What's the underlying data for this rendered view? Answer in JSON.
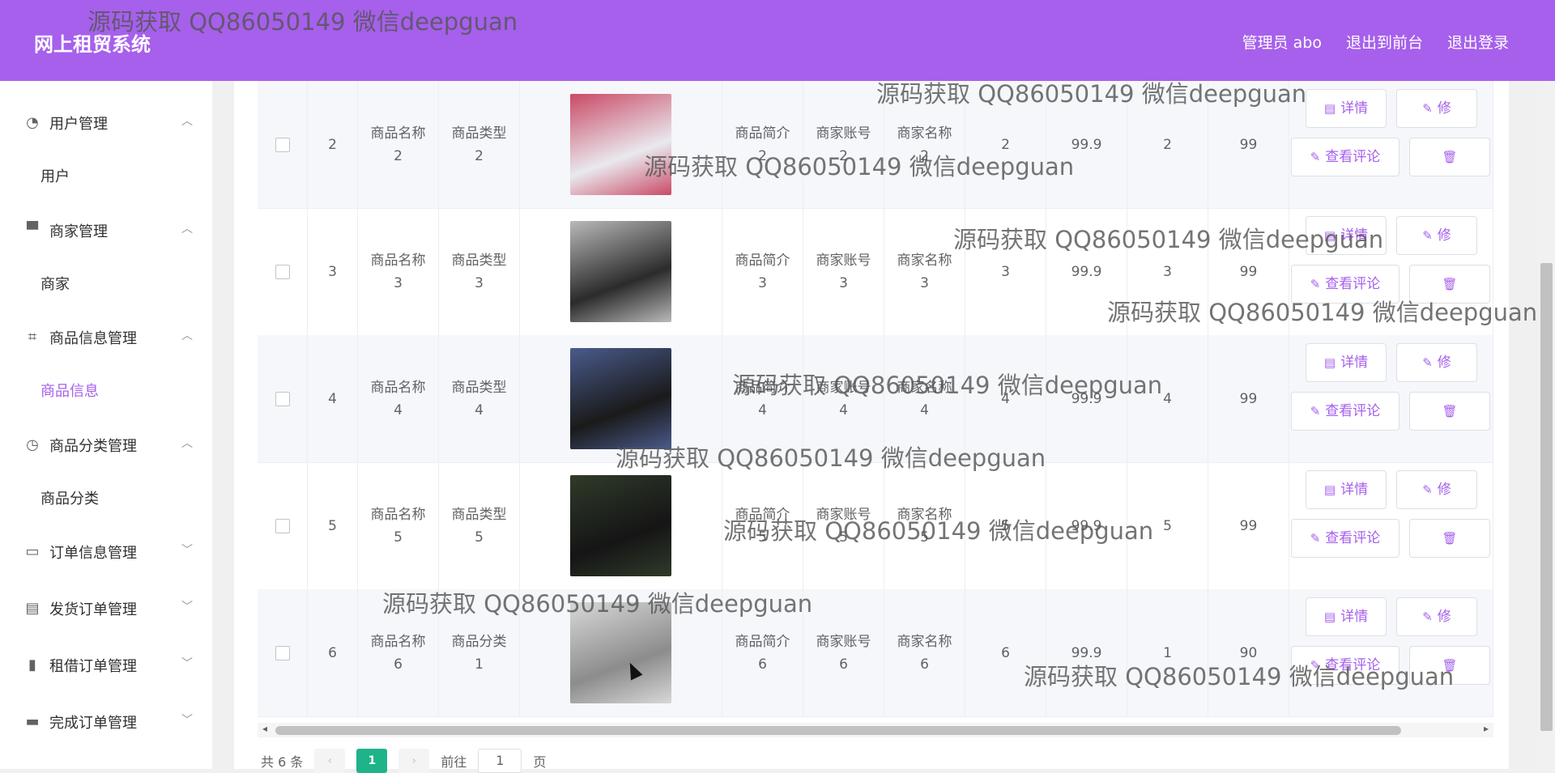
{
  "header": {
    "app_title": "网上租贸系统",
    "nav": [
      "管理员 abo",
      "退出到前台",
      "退出登录"
    ]
  },
  "sidebar": {
    "groups": [
      {
        "icon": "dashboard-icon",
        "label": "用户管理",
        "expanded": true,
        "items": [
          "用户"
        ]
      },
      {
        "icon": "brush-icon",
        "label": "商家管理",
        "expanded": true,
        "items": [
          "商家"
        ]
      },
      {
        "icon": "crop-icon",
        "label": "商品信息管理",
        "expanded": true,
        "items": [
          "商品信息"
        ],
        "active_item": "商品信息"
      },
      {
        "icon": "clock-icon",
        "label": "商品分类管理",
        "expanded": true,
        "items": [
          "商品分类"
        ]
      },
      {
        "icon": "chat-icon",
        "label": "订单信息管理",
        "expanded": false,
        "items": []
      },
      {
        "icon": "clipboard-icon",
        "label": "发货订单管理",
        "expanded": false,
        "items": []
      },
      {
        "icon": "chart-icon",
        "label": "租借订单管理",
        "expanded": false,
        "items": []
      },
      {
        "icon": "shop-icon",
        "label": "完成订单管理",
        "expanded": false,
        "items": []
      }
    ]
  },
  "table": {
    "rows": [
      {
        "index": "2",
        "name": [
          "商品名称",
          "2"
        ],
        "type": [
          "商品类型",
          "2"
        ],
        "image": "pc-case-pink",
        "intro": [
          "商品简介",
          "2"
        ],
        "account": [
          "商家账号",
          "2"
        ],
        "merchant": [
          "商家名称",
          "2"
        ],
        "c1": "2",
        "price": "99.9",
        "c2": "2",
        "c3": "99"
      },
      {
        "index": "3",
        "name": [
          "商品名称",
          "3"
        ],
        "type": [
          "商品类型",
          "3"
        ],
        "image": "pc-case-black",
        "intro": [
          "商品简介",
          "3"
        ],
        "account": [
          "商家账号",
          "3"
        ],
        "merchant": [
          "商家名称",
          "3"
        ],
        "c1": "3",
        "price": "99.9",
        "c2": "3",
        "c3": "99"
      },
      {
        "index": "4",
        "name": [
          "商品名称",
          "4"
        ],
        "type": [
          "商品类型",
          "4"
        ],
        "image": "phones",
        "intro": [
          "商品简介",
          "4"
        ],
        "account": [
          "商家账号",
          "4"
        ],
        "merchant": [
          "商家名称",
          "4"
        ],
        "c1": "4",
        "price": "99.9",
        "c2": "4",
        "c3": "99"
      },
      {
        "index": "5",
        "name": [
          "商品名称",
          "5"
        ],
        "type": [
          "商品类型",
          "5"
        ],
        "image": "laptop-black",
        "intro": [
          "商品简介",
          "5"
        ],
        "account": [
          "商家账号",
          "5"
        ],
        "merchant": [
          "商家名称",
          "5"
        ],
        "c1": "5",
        "price": "99.9",
        "c2": "5",
        "c3": "99"
      },
      {
        "index": "6",
        "name": [
          "商品名称",
          "6"
        ],
        "type": [
          "商品分类",
          "1"
        ],
        "image": "laptop-silver",
        "intro": [
          "商品简介",
          "6"
        ],
        "account": [
          "商家账号",
          "6"
        ],
        "merchant": [
          "商家名称",
          "6"
        ],
        "c1": "6",
        "price": "99.9",
        "c2": "1",
        "c3": "90"
      }
    ],
    "actions": {
      "detail": "详情",
      "edit": "修",
      "comments": "查看评论"
    }
  },
  "pagination": {
    "total": "共 6 条",
    "prev": "‹",
    "current": "1",
    "next": "›",
    "goto_prefix": "前往",
    "goto_value": "1",
    "goto_suffix": "页"
  },
  "watermark": "源码获取 QQ86050149 微信deepguan",
  "colors": {
    "header_bg": "#a660ec",
    "accent": "#a660ec",
    "page_active": "#1fb38a"
  }
}
